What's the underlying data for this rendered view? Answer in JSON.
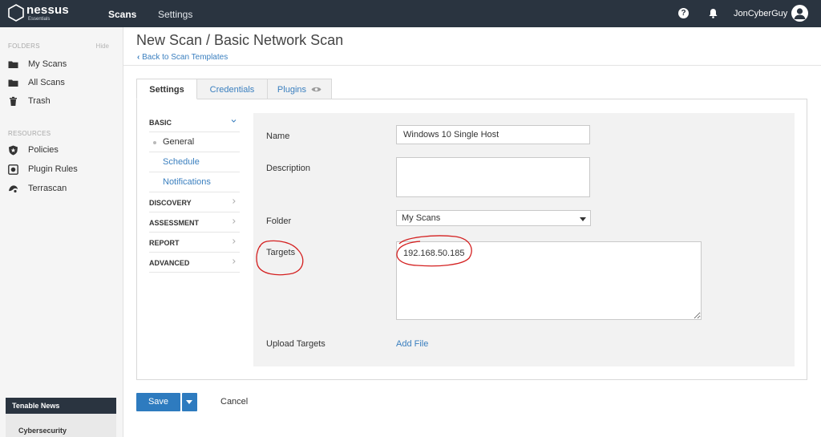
{
  "app": {
    "brand": "nessus",
    "brand_edition": "Essentials"
  },
  "topnav": {
    "items": [
      "Scans",
      "Settings"
    ],
    "user": "JonCyberGuy",
    "help_glyph": "?"
  },
  "sidebar": {
    "folders_heading": "FOLDERS",
    "hide_label": "Hide",
    "folders": [
      "My Scans",
      "All Scans",
      "Trash"
    ],
    "resources_heading": "RESOURCES",
    "resources": [
      "Policies",
      "Plugin Rules",
      "Terrascan"
    ],
    "news_heading": "Tenable News",
    "news_text": "Cybersecurity"
  },
  "page": {
    "title": "New Scan / Basic Network Scan",
    "back_link": "Back to Scan Templates"
  },
  "tabs": [
    "Settings",
    "Credentials",
    "Plugins"
  ],
  "submenu": {
    "basic": "BASIC",
    "basic_children": [
      "General",
      "Schedule",
      "Notifications"
    ],
    "sections": [
      "DISCOVERY",
      "ASSESSMENT",
      "REPORT",
      "ADVANCED"
    ]
  },
  "form": {
    "name_label": "Name",
    "name_value": "Windows 10 Single Host",
    "description_label": "Description",
    "description_value": "",
    "folder_label": "Folder",
    "folder_value": "My Scans",
    "targets_label": "Targets",
    "targets_value": "192.168.50.185",
    "upload_label": "Upload Targets",
    "add_file": "Add File"
  },
  "actions": {
    "save": "Save",
    "cancel": "Cancel"
  },
  "colors": {
    "topbar": "#2a3440",
    "link": "#3a7fbf",
    "primary": "#2e7bbf",
    "annotation": "#d42020"
  }
}
